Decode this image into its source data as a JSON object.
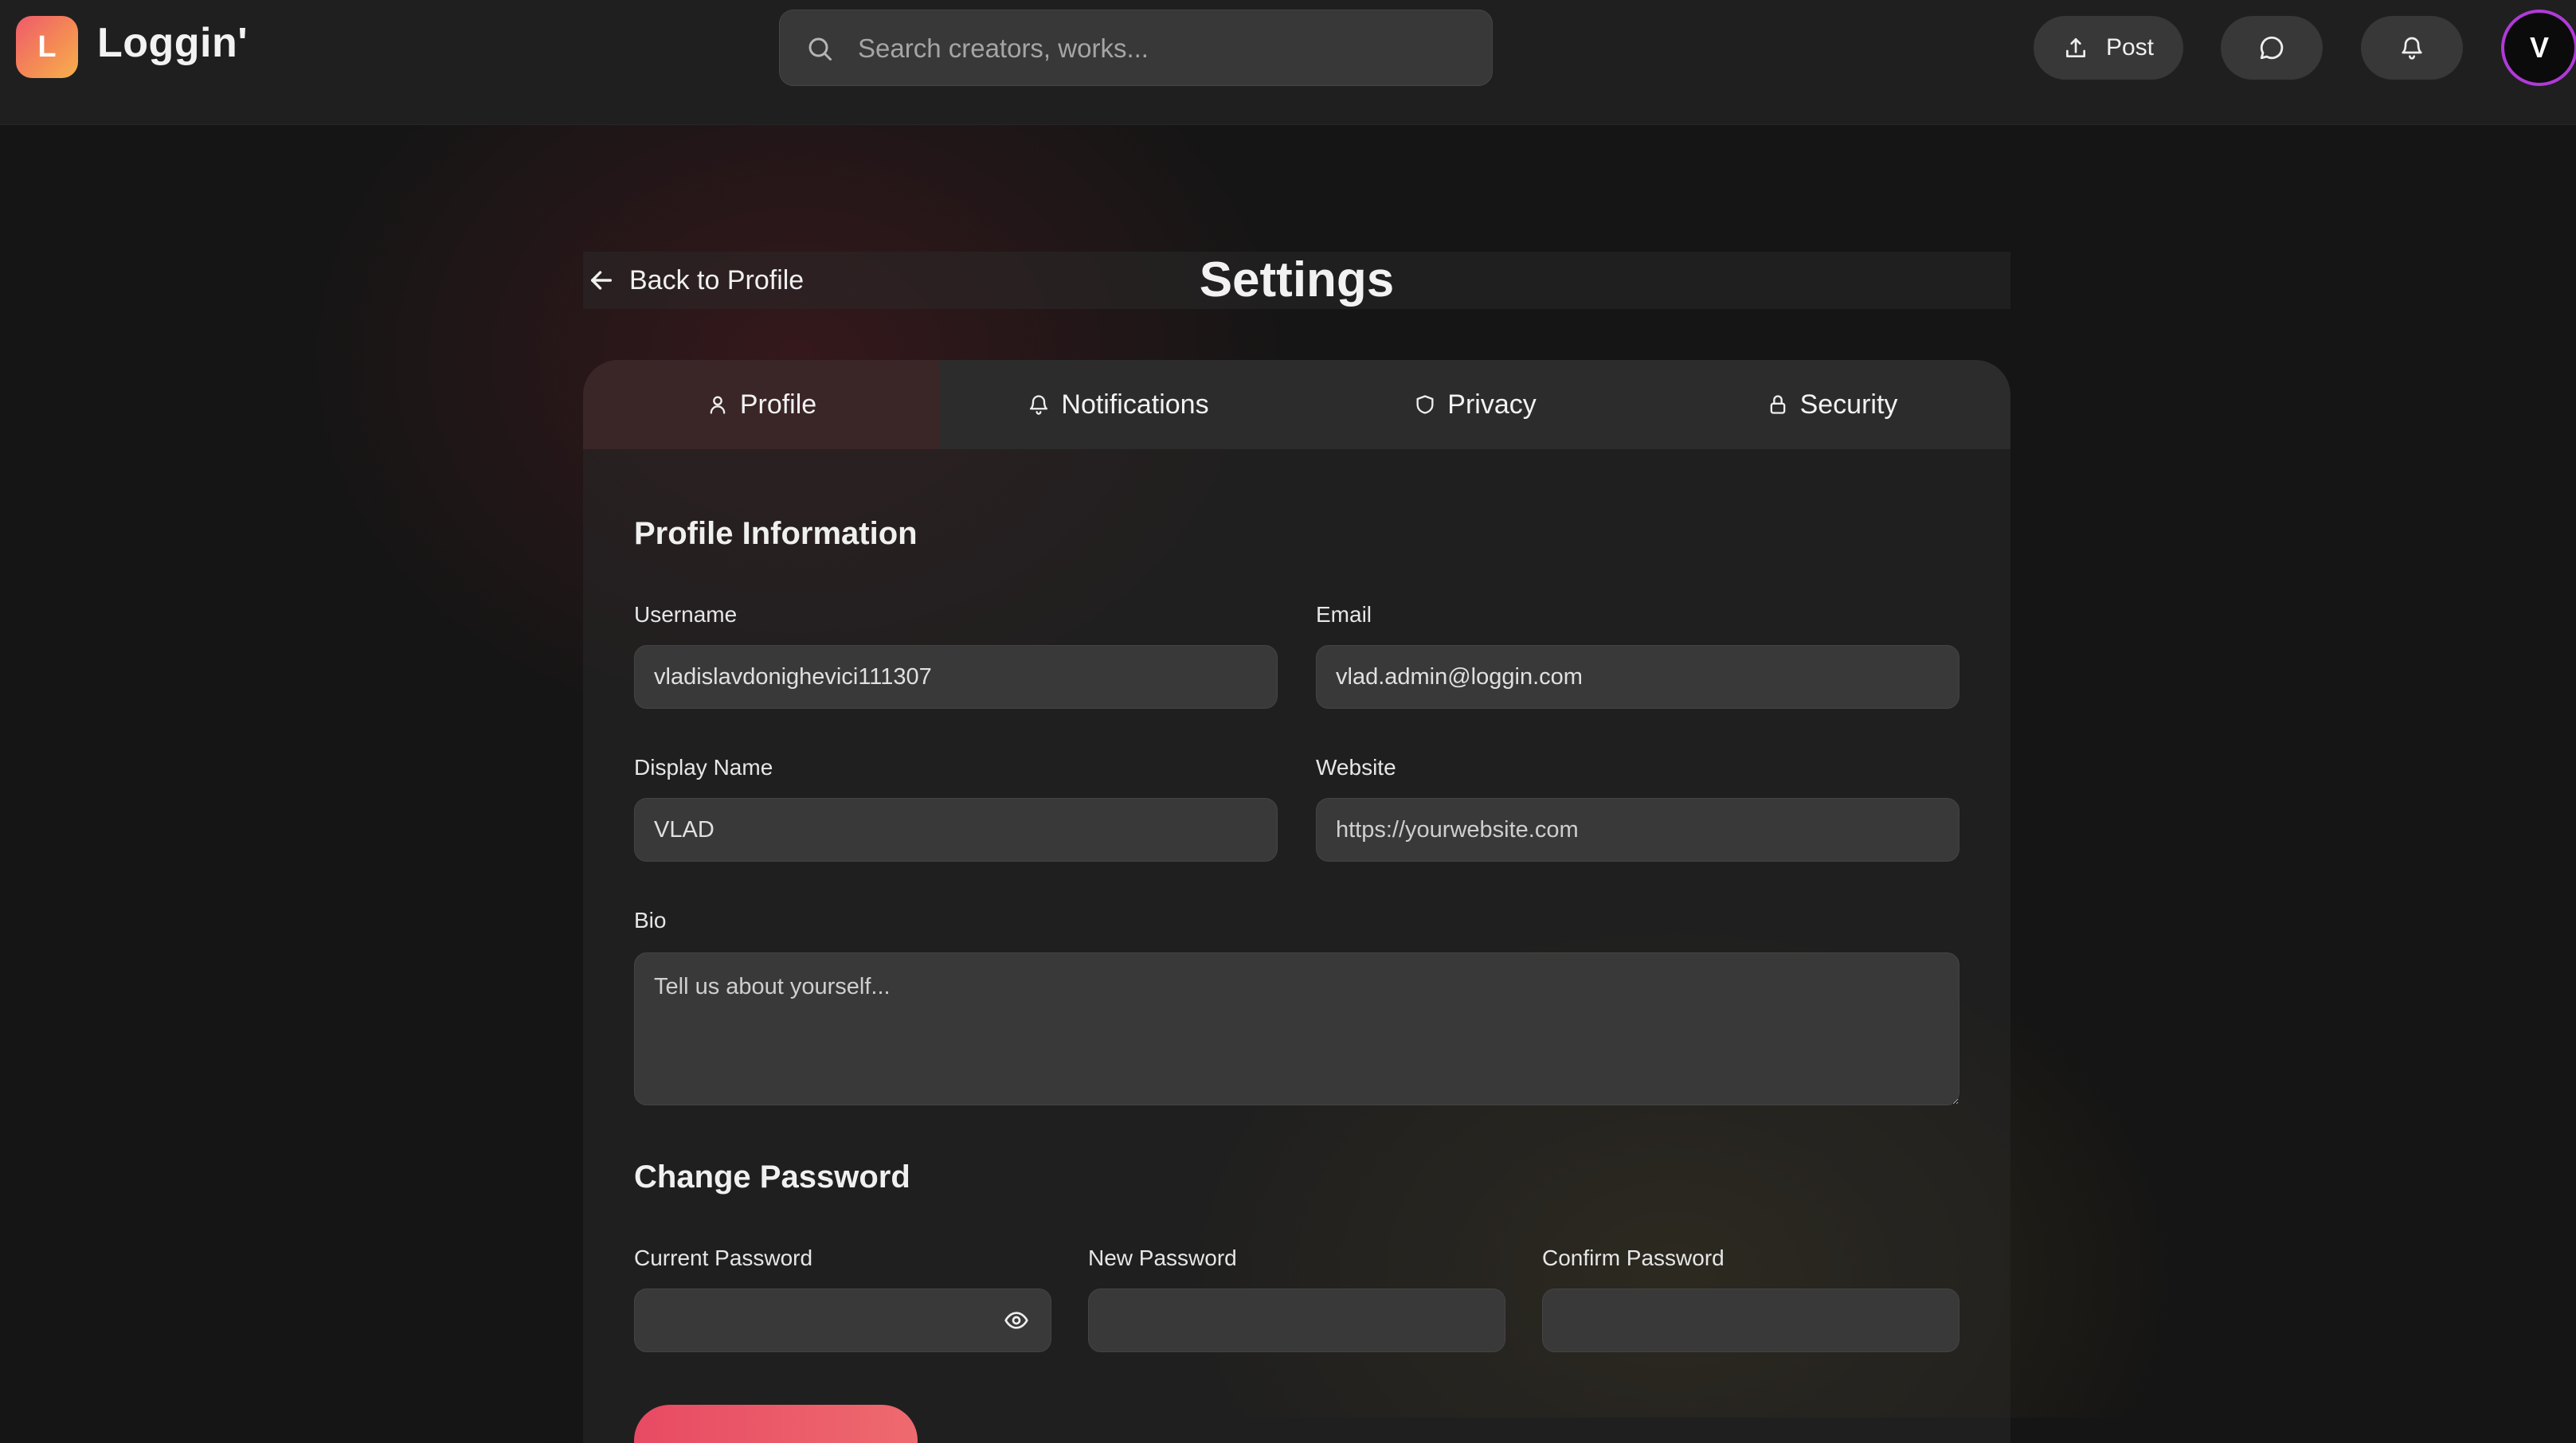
{
  "app": {
    "logo_letter": "L",
    "name": "Loggin'",
    "search_placeholder": "Search creators, works...",
    "post_label": "Post",
    "avatar_letter": "V",
    "colors": {
      "logo_gradient_start": "#ef5a6c",
      "logo_gradient_end": "#f7b04d",
      "avatar_ring": "#b03ad8",
      "accent": "#e84a63"
    }
  },
  "icons": {
    "search": "search-icon",
    "post": "upload-icon",
    "messages": "message-icon",
    "notifications": "bell-icon",
    "back": "arrow-left-icon"
  },
  "header": {
    "back_label": "Back to Profile",
    "title": "Settings"
  },
  "tabs": [
    {
      "label": "Profile",
      "icon": "user-icon",
      "active": true
    },
    {
      "label": "Notifications",
      "icon": "bell-icon",
      "active": false
    },
    {
      "label": "Privacy",
      "icon": "shield-icon",
      "active": false
    },
    {
      "label": "Security",
      "icon": "lock-icon",
      "active": false
    }
  ],
  "profile": {
    "section_title": "Profile Information",
    "username_label": "Username",
    "username_value": "vladislavdonighevici111307",
    "email_label": "Email",
    "email_value": "vlad.admin@loggin.com",
    "display_name_label": "Display Name",
    "display_name_value": "VLAD",
    "website_label": "Website",
    "website_placeholder": "https://yourwebsite.com",
    "bio_label": "Bio",
    "bio_placeholder": "Tell us about yourself..."
  },
  "password": {
    "section_title": "Change Password",
    "current_label": "Current Password",
    "new_label": "New Password",
    "confirm_label": "Confirm Password",
    "toggle_icon": "eye-icon"
  }
}
